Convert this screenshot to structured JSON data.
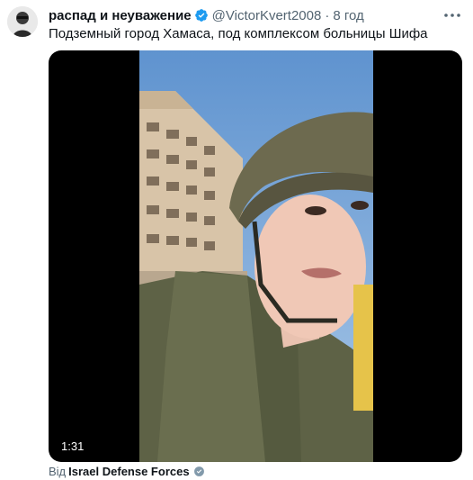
{
  "tweet": {
    "display_name": "распад и неуважение",
    "handle": "@VictorKvert2008",
    "separator": "·",
    "time": "8 год",
    "text": "Подземный город Хамаса, под комплексом больницы Шифа"
  },
  "media": {
    "duration": "1:31"
  },
  "source": {
    "prefix": "Від",
    "name": "Israel Defense Forces"
  },
  "colors": {
    "verified": "#1d9bf0",
    "secondary_text": "#536471",
    "primary_text": "#0f1419",
    "media_bg": "#000000"
  },
  "icons": {
    "verified": "verified-badge-icon",
    "more": "more-horizontal-icon",
    "source_badge": "government-badge-icon"
  }
}
